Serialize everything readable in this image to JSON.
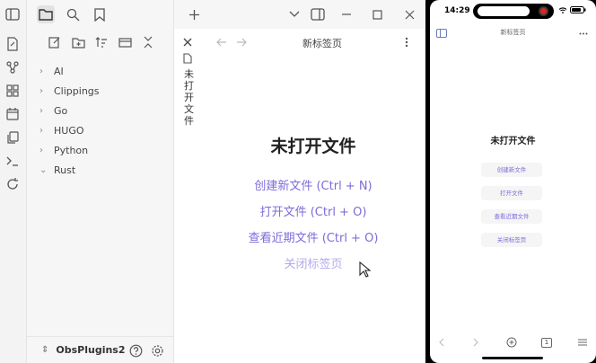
{
  "sidebar": {
    "tree": [
      {
        "label": "AI",
        "expanded": false
      },
      {
        "label": "Clippings",
        "expanded": false
      },
      {
        "label": "Go",
        "expanded": false
      },
      {
        "label": "HUGO",
        "expanded": false
      },
      {
        "label": "Python",
        "expanded": false
      },
      {
        "label": "Rust",
        "expanded": true
      }
    ],
    "vault_name": "ObsPlugins2"
  },
  "desktop": {
    "vertical_tab_title": "未打开文件",
    "pane_title": "新标签页",
    "empty_title": "未打开文件",
    "actions": {
      "create": "创建新文件 (Ctrl + N)",
      "open": "打开文件 (Ctrl + O)",
      "recent": "查看近期文件 (Ctrl + O)",
      "close": "关闭标签页"
    }
  },
  "phone": {
    "time": "14:29",
    "title": "新标签页",
    "empty_title": "未打开文件",
    "actions": {
      "create": "创建新文件",
      "open": "打开文件",
      "recent": "查看近期文件",
      "close": "关闭标签页"
    },
    "tab_count": "1"
  },
  "colors": {
    "accent": "#7b6cd9",
    "accent_dim": "#b3aaea",
    "record": "#d9262b"
  }
}
